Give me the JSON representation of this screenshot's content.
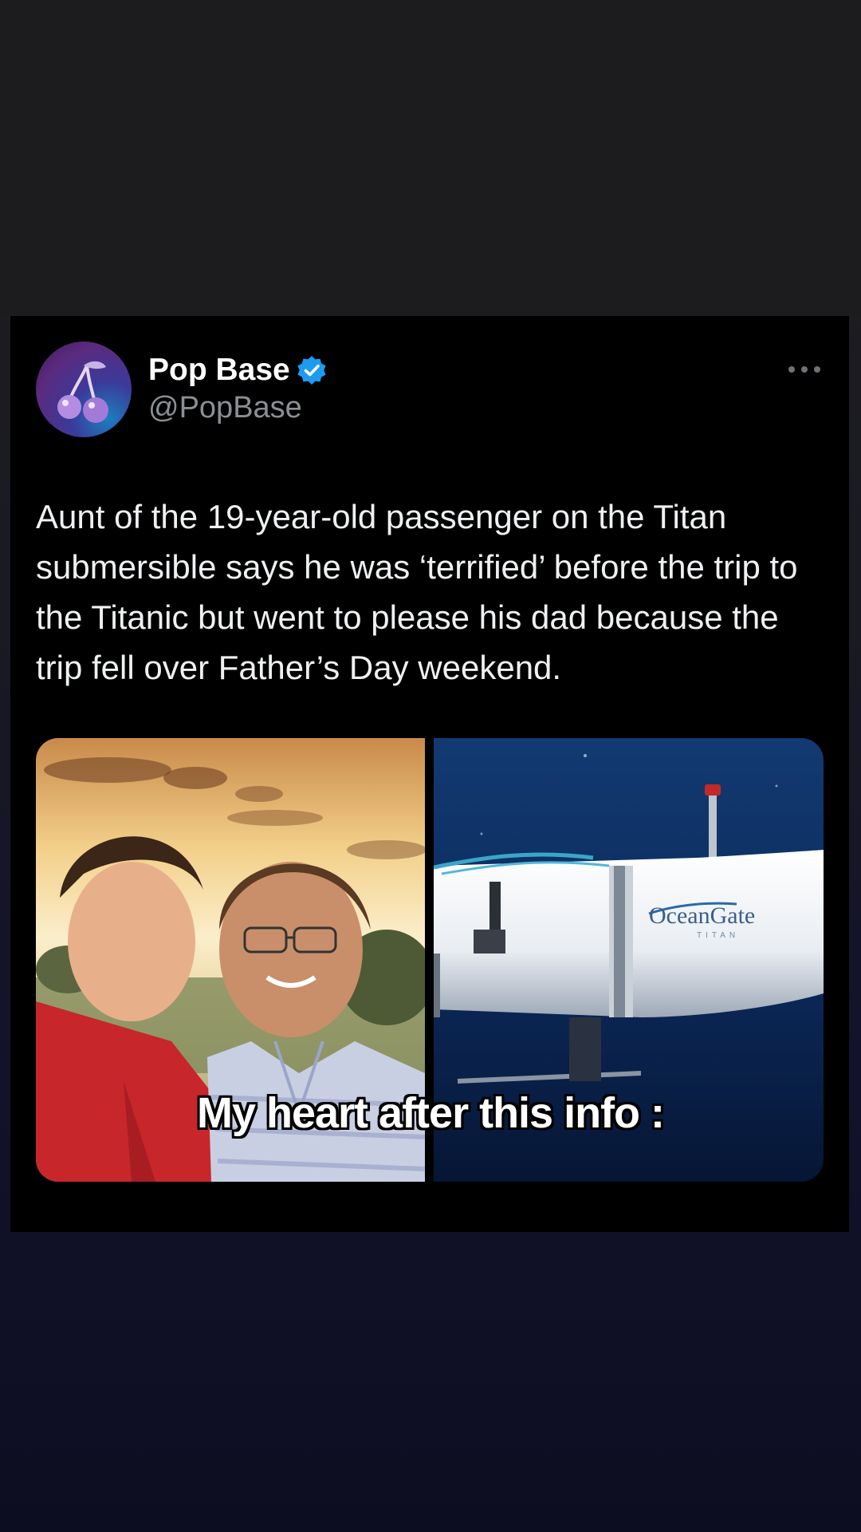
{
  "tweet": {
    "author_name": "Pop Base",
    "author_handle": "@PopBase",
    "verified": true,
    "avatar_icon": "cherries-icon",
    "text": "Aunt of the 19-year-old passenger on the Titan submersible says he was ‘terrified’ before the trip to the Titanic but went to please his dad because the trip fell over Father’s Day weekend.",
    "more_icon": "more-horizontal-icon",
    "media": [
      {
        "description": "selfie-photo"
      },
      {
        "brand": "OceanGate",
        "model": "TITAN"
      }
    ]
  },
  "overlay": {
    "caption": "My heart after this info :"
  },
  "colors": {
    "verified_blue": "#1d9bf0",
    "card_bg": "#000000",
    "handle_gray": "#8b8f95"
  }
}
